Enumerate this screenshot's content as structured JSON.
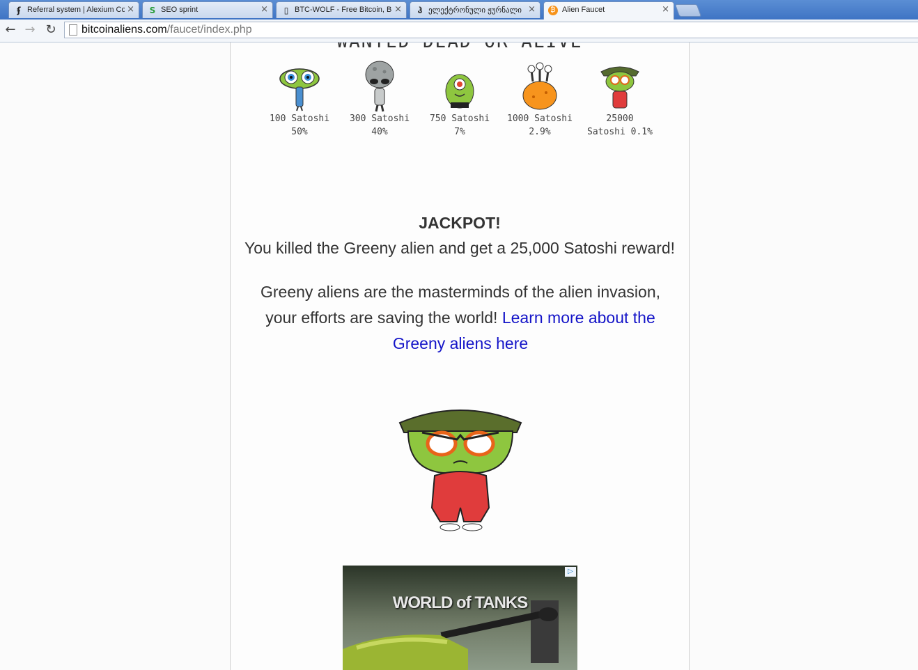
{
  "browser": {
    "tabs": [
      {
        "title": "Referral system | Alexium Co",
        "icon": "alexium-icon",
        "active": false
      },
      {
        "title": "SEO sprint",
        "icon": "seosprint-icon",
        "active": false
      },
      {
        "title": "BTC-WOLF - Free Bitcoin, Bit",
        "icon": "page-icon",
        "active": false
      },
      {
        "title": "ელექტრონული ჟურნალი",
        "icon": "georgian-icon",
        "active": false
      },
      {
        "title": "Alien Faucet",
        "icon": "bitcoin-icon",
        "active": true
      }
    ],
    "close_glyph": "×",
    "url_host": "bitcoinaliens.com",
    "url_path": "/faucet/index.php"
  },
  "page": {
    "heading_cut": "WANTED DEAD OR ALIVE",
    "aliens": [
      {
        "reward": "100 Satoshi",
        "chance": "50%"
      },
      {
        "reward": "300 Satoshi",
        "chance": "40%"
      },
      {
        "reward": "750 Satoshi",
        "chance": "7%"
      },
      {
        "reward": "1000 Satoshi",
        "chance": "2.9%"
      },
      {
        "reward": "25000",
        "chance": "Satoshi 0.1%"
      }
    ],
    "jackpot": "JACKPOT!",
    "reward_text": "You killed the Greeny alien and get a 25,000 Satoshi reward!",
    "desc_text": "Greeny aliens are the masterminds of the alien invasion, your efforts are saving the world!",
    "learn_more": "Learn more about the Greeny aliens here",
    "ad_brand": "WORLD of TANKS"
  },
  "colors": {
    "tab_strip": "#3e74c4",
    "link": "#1414c8",
    "text": "#333333",
    "greeny_green": "#8ec63f",
    "greeny_suit": "#e03c3c"
  }
}
